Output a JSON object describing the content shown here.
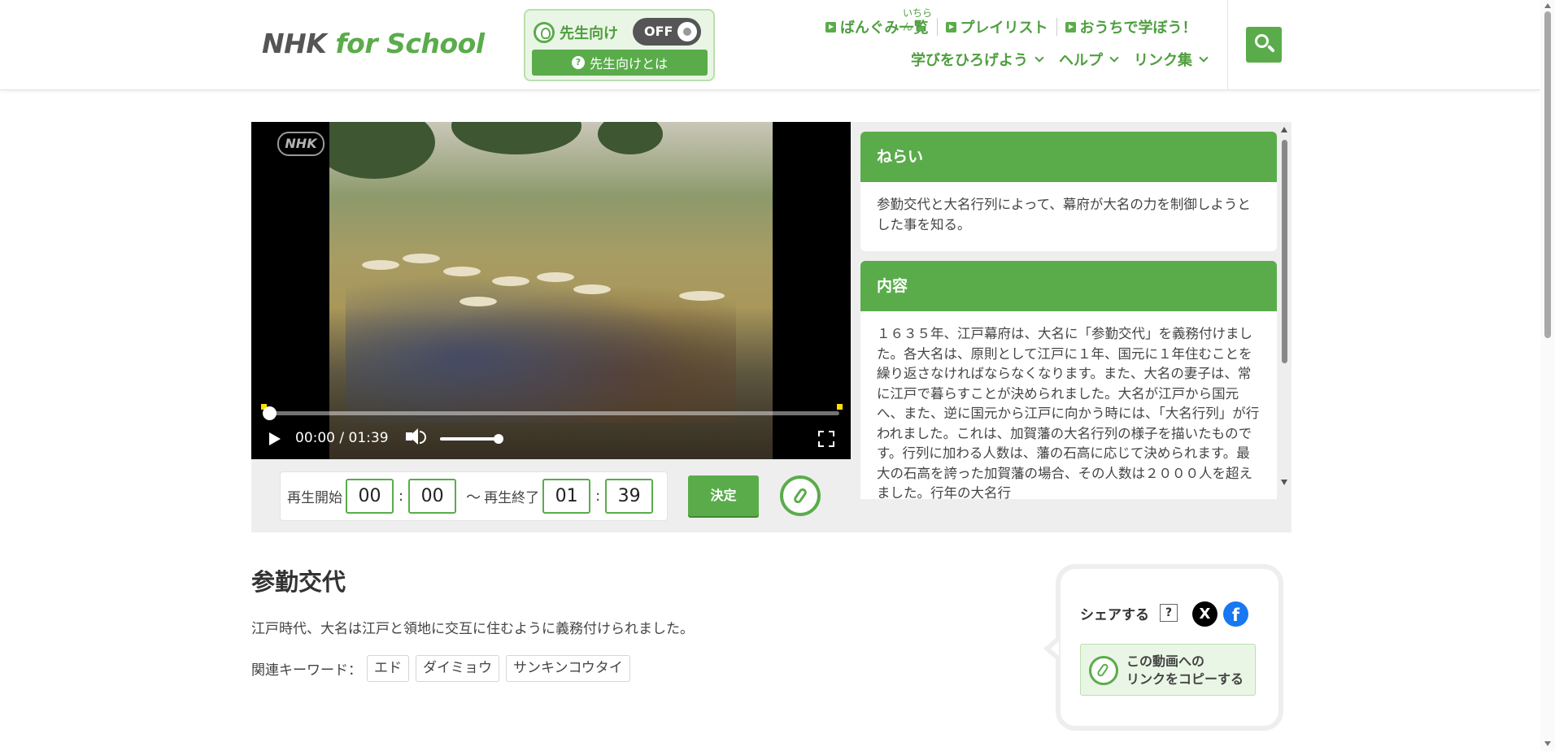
{
  "header": {
    "logo": {
      "nhk": "NHK",
      "for": "for",
      "school": "School"
    },
    "teacher": {
      "label": "先生向け",
      "toggle": "OFF",
      "about": "先生向けとは"
    },
    "nav": [
      {
        "label": "ばんぐみ一覧",
        "ruby": "いちらん"
      },
      {
        "label": "プレイリスト"
      },
      {
        "label": "おうちで学ぼう！"
      }
    ],
    "subnav": [
      "学びをひろげよう",
      "ヘルプ",
      "リンク集"
    ]
  },
  "player": {
    "watermark": "NHK",
    "time": "00:00 / 01:39",
    "progress": 0,
    "volume": 1,
    "range": {
      "start_label": "再生開始",
      "end_label": "再生終了",
      "tilde": "～",
      "start_min": "00",
      "start_sec": "00",
      "end_min": "01",
      "end_sec": "39"
    },
    "decide": "決定"
  },
  "side": {
    "aim_title": "ねらい",
    "aim_body": "参勤交代と大名行列によって、幕府が大名の力を制御しようとした事を知る。",
    "content_title": "内容",
    "content_body": "１６３５年、江戸幕府は、大名に「参勤交代」を義務付けました。各大名は、原則として江戸に１年、国元に１年住むことを繰り返さなければならなくなります。また、大名の妻子は、常に江戸で暮らすことが決められました。大名が江戸から国元へ、また、逆に国元から江戸に向かう時には、「大名行列」が行われました。これは、加賀藩の大名行列の様子を描いたものです。行列に加わる人数は、藩の石高に応じて決められます。最大の石高を誇った加賀藩の場合、その人数は２０００人を超えました。行年の大名行"
  },
  "info": {
    "title": "参勤交代",
    "desc": "江戸時代、大名は江戸と領地に交互に住むように義務付けられました。",
    "keywords_label": "関連キーワード：",
    "keywords": [
      "エド",
      "ダイミョウ",
      "サンキンコウタイ"
    ]
  },
  "share": {
    "label": "シェアする",
    "help": "?",
    "x": "X",
    "fb": "f",
    "copy_line1": "この動画への",
    "copy_line2": "リンクをコピーする"
  }
}
